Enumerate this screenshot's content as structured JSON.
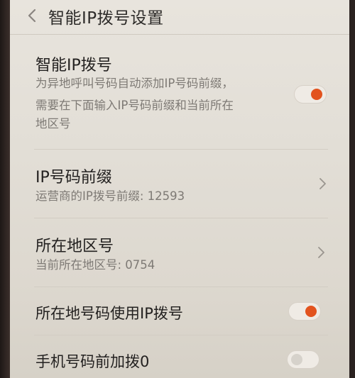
{
  "header": {
    "title": "智能IP拨号设置"
  },
  "settings": {
    "smart_ip": {
      "title": "智能IP拨号",
      "desc_line1": "为异地呼叫号码自动添加IP号码前缀，",
      "desc_line2": "需要在下面输入IP号码前缀和当前所在",
      "desc_line3": "地区号",
      "enabled": true
    },
    "ip_prefix": {
      "title": "IP号码前缀",
      "subtitle": "运营商的IP拨号前缀: 12593"
    },
    "area_code": {
      "title": "所在地区号",
      "subtitle": "当前所在地区号: 0754"
    },
    "local_use_ip": {
      "title": "所在地号码使用IP拨号",
      "enabled": true
    },
    "add_zero": {
      "title": "手机号码前加拨0",
      "enabled": false
    }
  },
  "colors": {
    "accent": "#e2531e",
    "background": "#e5e1da"
  }
}
